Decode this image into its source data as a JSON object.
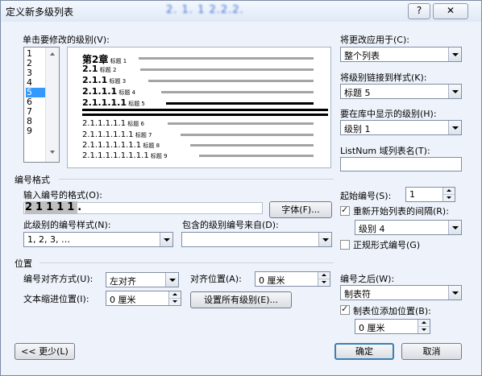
{
  "window": {
    "title": "定义新多级列表",
    "blurred_title": "2. 1. 1 2.2.2.",
    "help_label": "?",
    "close_label": "✕"
  },
  "level_section": {
    "label": "单击要修改的级别(V):",
    "levels": [
      "1",
      "2",
      "3",
      "4",
      "5",
      "6",
      "7",
      "8",
      "9"
    ],
    "selected_level": "5"
  },
  "preview": {
    "lines": [
      {
        "number": "第2章",
        "caption": "标题 1"
      },
      {
        "number": "2.1",
        "caption": "标题 2"
      },
      {
        "number": "2.1.1",
        "caption": "标题 3"
      },
      {
        "number": "2.1.1.1",
        "caption": "标题 4"
      },
      {
        "number": "2.1.1.1.1",
        "caption": "标题 5"
      },
      {
        "number": "2.1.1.1.1.1",
        "caption": "标题 6"
      },
      {
        "number": "2.1.1.1.1.1.1",
        "caption": "标题 7"
      },
      {
        "number": "2.1.1.1.1.1.1.1",
        "caption": "标题 8"
      },
      {
        "number": "2.1.1.1.1.1.1.1.1",
        "caption": "标题 9"
      }
    ]
  },
  "right_panel": {
    "apply_to_label": "将更改应用于(C):",
    "apply_to_value": "整个列表",
    "link_style_label": "将级别链接到样式(K):",
    "link_style_value": "标题 5",
    "gallery_level_label": "要在库中显示的级别(H):",
    "gallery_level_value": "级别 1",
    "listnum_label": "ListNum 域列表名(T):",
    "listnum_value": ""
  },
  "number_format": {
    "section_label": "编号格式",
    "enter_format_label": "输入编号的格式(O):",
    "format_prefix": "2.1.1.1.1",
    "format_shaded": [
      "2",
      "1",
      "1",
      "1",
      "1"
    ],
    "format_suffix": ".",
    "font_button": "字体(F)...",
    "number_style_label": "此级别的编号样式(N):",
    "number_style_value": "1, 2, 3, …",
    "include_level_label": "包含的级别编号来自(D):",
    "include_level_value": "",
    "start_at_label": "起始编号(S):",
    "start_at_value": "1",
    "restart_label": "重新开始列表的间隔(R):",
    "restart_checked": true,
    "restart_value": "级别 4",
    "legal_label": "正规形式编号(G)",
    "legal_checked": false
  },
  "position": {
    "section_label": "位置",
    "alignment_label": "编号对齐方式(U):",
    "alignment_value": "左对齐",
    "aligned_at_label": "对齐位置(A):",
    "aligned_at_value": "0 厘米",
    "indent_label": "文本缩进位置(I):",
    "indent_value": "0 厘米",
    "set_all_button": "设置所有级别(E)...",
    "follow_label": "编号之后(W):",
    "follow_value": "制表符",
    "tab_add_label": "制表位添加位置(B):",
    "tab_add_checked": true,
    "tab_add_value": "0 厘米"
  },
  "footer": {
    "less_button": "<< 更少(L)",
    "ok_button": "确定",
    "cancel_button": "取消"
  }
}
